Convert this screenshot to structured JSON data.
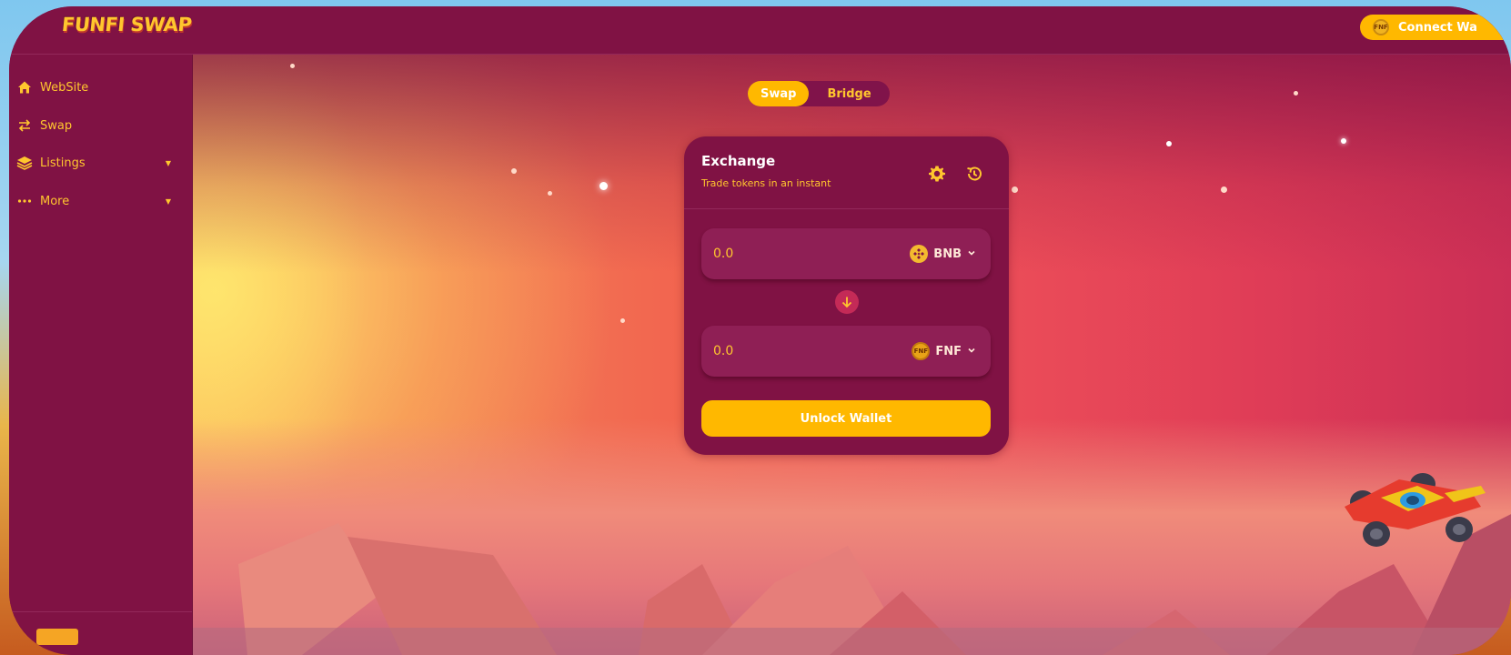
{
  "header": {
    "logo_text": "FUNFI SWAP",
    "connect_label": "Connect Wa",
    "connect_icon": "fnf-coin-icon"
  },
  "sidebar": {
    "items": [
      {
        "label": "WebSite",
        "icon": "home-icon"
      },
      {
        "label": "Swap",
        "icon": "swap-arrows-icon"
      },
      {
        "label": "Listings",
        "icon": "layers-icon",
        "expandable": true
      },
      {
        "label": "More",
        "icon": "more-dots-icon",
        "expandable": true
      }
    ]
  },
  "tabs": [
    {
      "label": "Swap",
      "active": true
    },
    {
      "label": "Bridge",
      "active": false
    }
  ],
  "exchange": {
    "title": "Exchange",
    "subtitle": "Trade tokens in an instant",
    "from": {
      "value": "0.0",
      "token": "BNB"
    },
    "to": {
      "value": "0.0",
      "token": "FNF"
    },
    "unlock_label": "Unlock Wallet"
  },
  "colors": {
    "brand": "#801244",
    "accent": "#ffb800",
    "text_accent": "#ffc62e"
  }
}
